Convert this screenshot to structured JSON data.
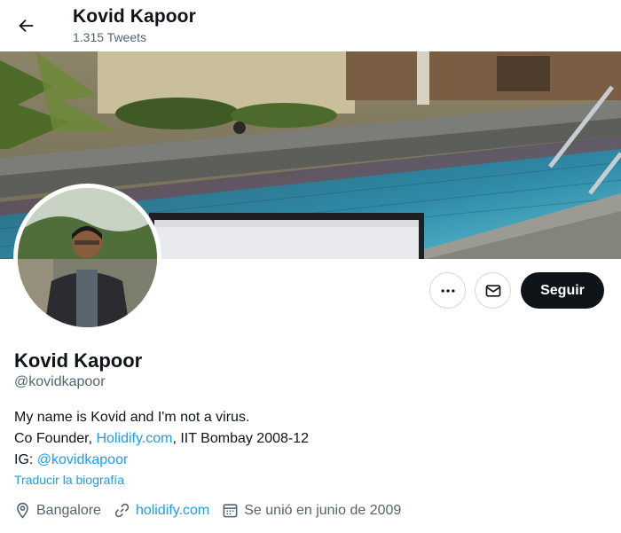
{
  "header": {
    "title": "Kovid Kapoor",
    "tweet_count": "1.315 Tweets"
  },
  "profile": {
    "name": "Kovid Kapoor",
    "handle": "@kovidkapoor",
    "bio_line1": "My name is Kovid and I'm not a virus.",
    "bio_line2_prefix": "Co Founder, ",
    "bio_line2_link": "Holidify.com",
    "bio_line2_suffix": ", IIT Bombay 2008-12",
    "bio_line3_prefix": "IG: ",
    "bio_line3_link": "@kovidkapoor",
    "translate_label": "Traducir la biografía",
    "location": "Bangalore",
    "website": "holidify.com",
    "joined": "Se unió en junio de 2009"
  },
  "actions": {
    "more_icon": "more-horizontal-icon",
    "message_icon": "mail-icon",
    "follow_label": "Seguir"
  },
  "colors": {
    "accent": "#1d9bf0",
    "text": "#0f1419",
    "secondary": "#536471",
    "follow_bg": "#0f1419"
  }
}
